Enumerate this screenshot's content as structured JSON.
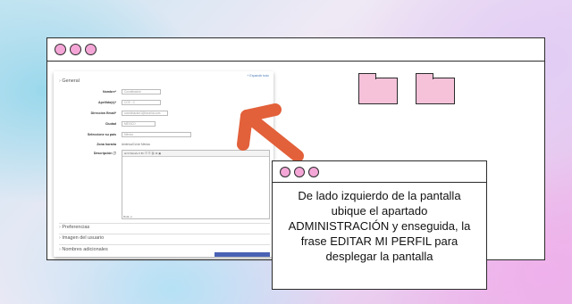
{
  "screenshot": {
    "top_link": "+ Expandir todo",
    "section_general": "General",
    "fields": [
      {
        "label": "Nombre*",
        "value": "Coordinación"
      },
      {
        "label": "Apellido(s)*",
        "value": "CCE - C"
      },
      {
        "label": "Dirección Email*",
        "value": "coordinacion1@lorunlut.com"
      },
      {
        "label": "Ciudad",
        "value": "MEXICO"
      },
      {
        "label": "Seleccione su país",
        "value": "México"
      },
      {
        "label": "Zona horaria",
        "value": "América/Cd de México"
      },
      {
        "label": "Descripción ⓘ",
        "value": ""
      }
    ],
    "editor_toolbar": "⊞ ▾  Párrafo  ▾  B  I  ☰  ☰  ⛓  ⊠  ▣",
    "editor_footer": "Ruta: p",
    "sections": [
      "Preferencias",
      "Imagen del usuario",
      "Nombres adicionales"
    ]
  },
  "caption": {
    "text": "De lado izquierdo de la pantalla ubique el apartado ADMINISTRACIÓN y enseguida, la frase EDITAR MI PERFIL para desplegar la pantalla"
  },
  "icons": {
    "window_dots": "traffic-light-dots",
    "folders": "folder-icon",
    "arrow": "arrow-icon"
  },
  "colors": {
    "dot_fill": "#f4a6d7",
    "folder_fill": "#f5c2da",
    "arrow": "#e2603a",
    "outline": "#2b2b2b"
  }
}
